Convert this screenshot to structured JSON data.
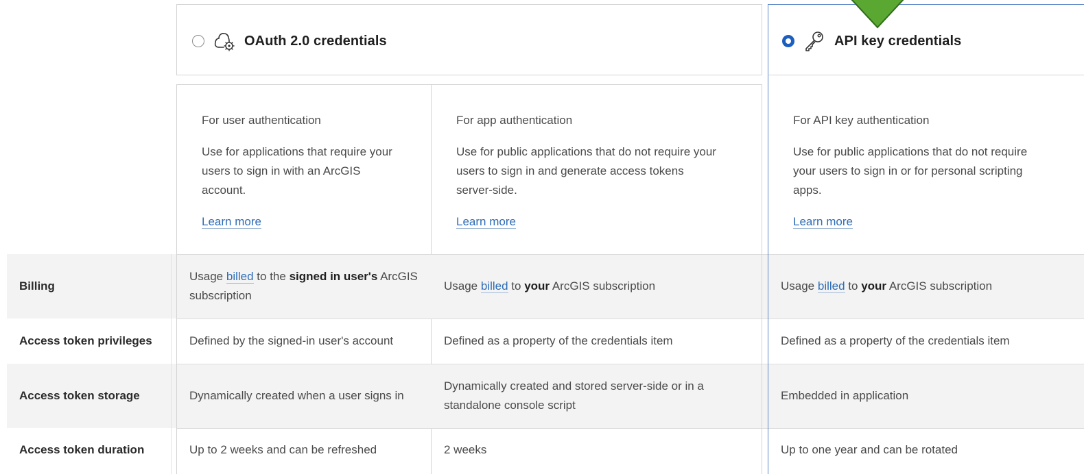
{
  "options": [
    {
      "title": "OAuth 2.0 credentials",
      "selected": false,
      "icon": "oauth-cloud-gear-icon"
    },
    {
      "title": "API key credentials",
      "selected": true,
      "icon": "key-icon"
    }
  ],
  "descriptions": {
    "user_auth": {
      "heading": "For user authentication",
      "body": "Use for applications that require your users to sign in with an ArcGIS account.",
      "link": "Learn more"
    },
    "app_auth": {
      "heading": "For app authentication",
      "body": "Use for public applications that do not require your users to sign in and generate access tokens server-side.",
      "link": "Learn more"
    },
    "api_key_auth": {
      "heading": "For API key authentication",
      "body": "Use for public applications that do not require your users to sign in or for personal scripting apps.",
      "link": "Learn more"
    }
  },
  "rows": {
    "billing": {
      "label": "Billing",
      "user": {
        "pre": "Usage ",
        "link": "billed",
        "mid": " to the ",
        "bold": "signed in user's",
        "post": " ArcGIS subscription"
      },
      "app": {
        "pre": "Usage ",
        "link": "billed",
        "mid": " to ",
        "bold": "your",
        "post": " ArcGIS subscription"
      },
      "apikey": {
        "pre": "Usage ",
        "link": "billed",
        "mid": " to ",
        "bold": "your",
        "post": " ArcGIS subscription"
      }
    },
    "privileges": {
      "label": "Access token privileges",
      "user": "Defined by the signed-in user's account",
      "app": "Defined as a property of the credentials item",
      "apikey": "Defined as a property of the credentials item"
    },
    "storage": {
      "label": "Access token storage",
      "user": "Dynamically created when a user signs in",
      "app": "Dynamically created and stored server-side or in a standalone console script",
      "apikey": "Embedded in application"
    },
    "duration": {
      "label": "Access token duration",
      "user": "Up to 2 weeks and can be refreshed",
      "app": "2 weeks",
      "apikey": "Up to one year and can be rotated"
    }
  },
  "colors": {
    "accent": "#1d5fbf",
    "link": "#2e6cb5",
    "selected_border": "#5b87c7",
    "pointer_arrow": "#5aa832"
  }
}
